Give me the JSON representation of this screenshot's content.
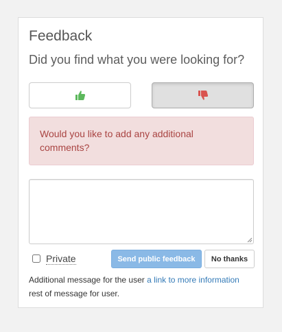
{
  "feedback": {
    "title": "Feedback",
    "question": "Did you find what you were looking for?",
    "thumbs_up_icon": "thumbs-up-icon",
    "thumbs_down_icon": "thumbs-down-icon",
    "thumbs_up_color": "#5cb85c",
    "thumbs_down_color": "#d9534f",
    "selected_vote": "down",
    "alert_text": "Would you like to add any additional comments?",
    "comment_value": "",
    "private_label": "Private",
    "private_checked": false,
    "send_label": "Send public feedback",
    "no_thanks_label": "No thanks",
    "message_prefix": "Additional message for the user ",
    "message_link": "a link to more information",
    "message_suffix": "rest of message for user."
  }
}
